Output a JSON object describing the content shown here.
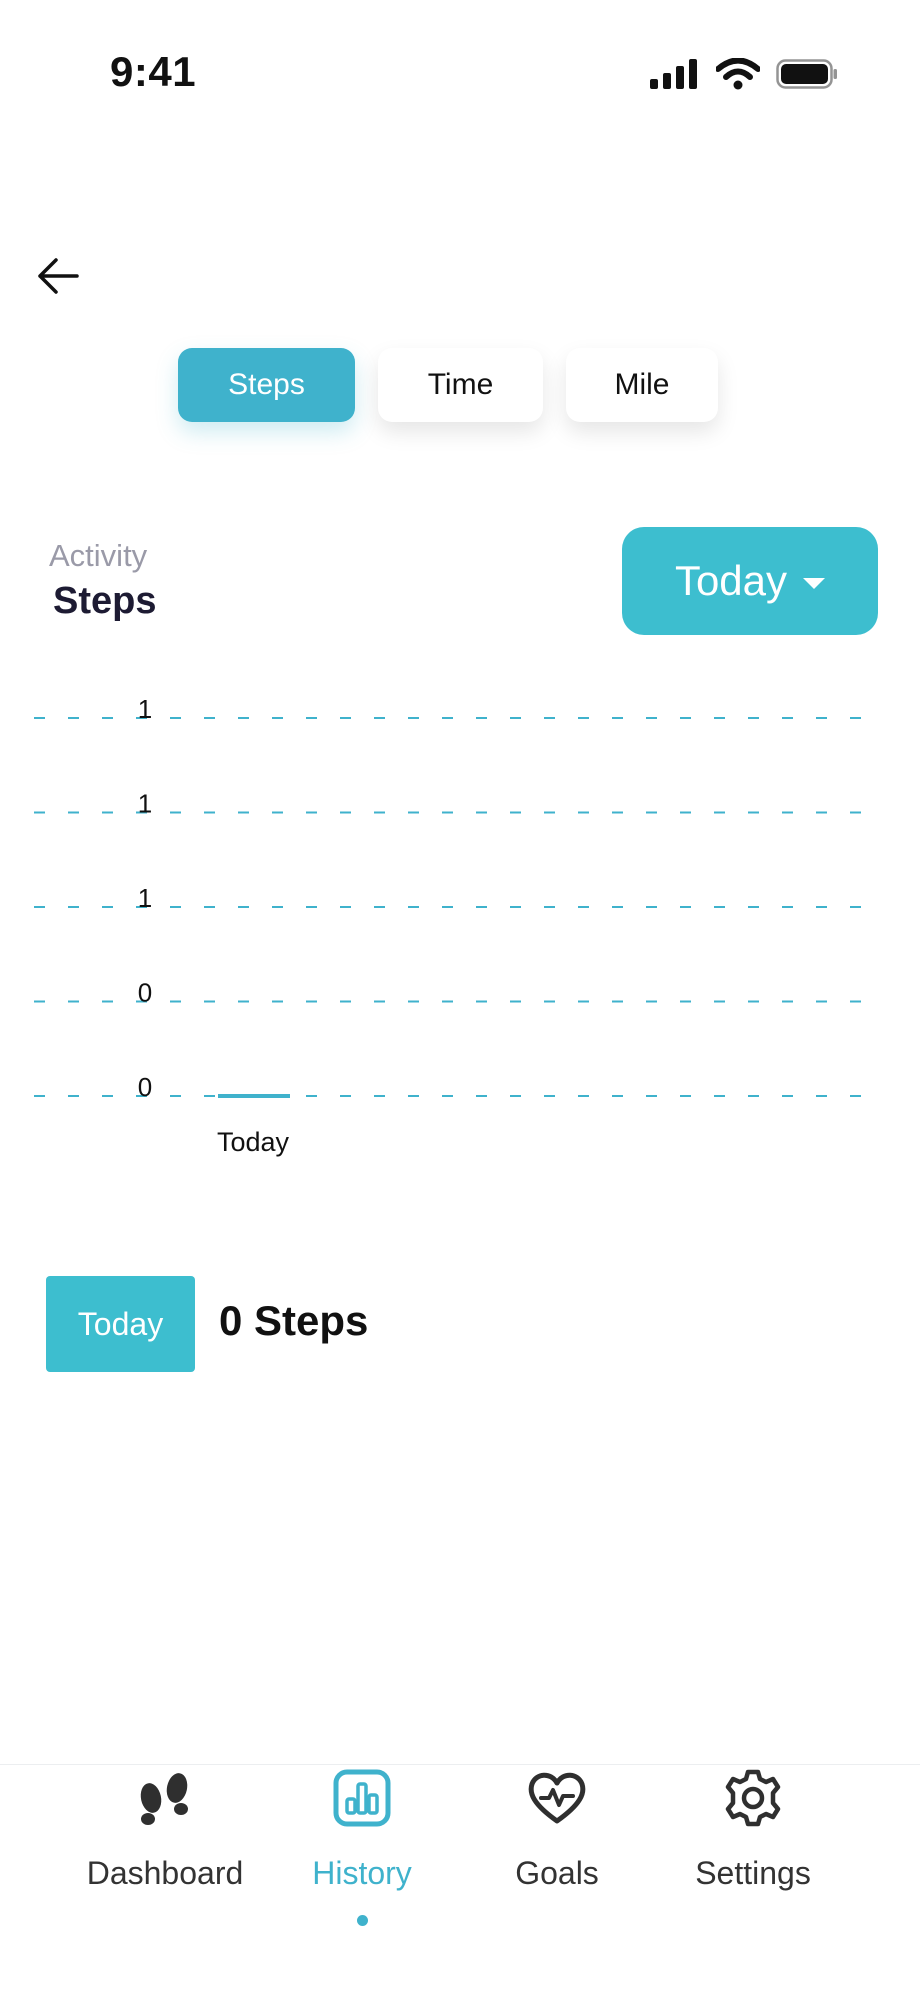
{
  "status_bar": {
    "time": "9:41",
    "icons": [
      "cellular-signal-icon",
      "wifi-icon",
      "battery-icon"
    ]
  },
  "header": {
    "back_icon": "back-arrow-icon"
  },
  "tabs": [
    {
      "label": "Steps",
      "active": true
    },
    {
      "label": "Time",
      "active": false
    },
    {
      "label": "Mile",
      "active": false
    }
  ],
  "activity": {
    "label": "Activity",
    "metric": "Steps"
  },
  "range_dropdown": {
    "selected": "Today",
    "icon": "caret-down-icon"
  },
  "chart_data": {
    "type": "bar",
    "categories": [
      "Today"
    ],
    "values": [
      0
    ],
    "ylim": [
      0,
      1
    ],
    "y_tick_labels": [
      "1",
      "1",
      "1",
      "0",
      "0"
    ],
    "grid": true,
    "grid_style": "dashed",
    "color": "#3fb2cc"
  },
  "summary": {
    "period": "Today",
    "value_text": "0 Steps"
  },
  "bottom_nav": [
    {
      "label": "Dashboard",
      "icon": "footprints-icon",
      "active": false
    },
    {
      "label": "History",
      "icon": "bar-chart-icon",
      "active": true
    },
    {
      "label": "Goals",
      "icon": "heart-pulse-icon",
      "active": false
    },
    {
      "label": "Settings",
      "icon": "gear-icon",
      "active": false
    }
  ],
  "colors": {
    "accent": "#3fb2cc",
    "accent_alt": "#3dbecf",
    "muted_text": "#9a9aa8",
    "title_text": "#1d1b33"
  }
}
